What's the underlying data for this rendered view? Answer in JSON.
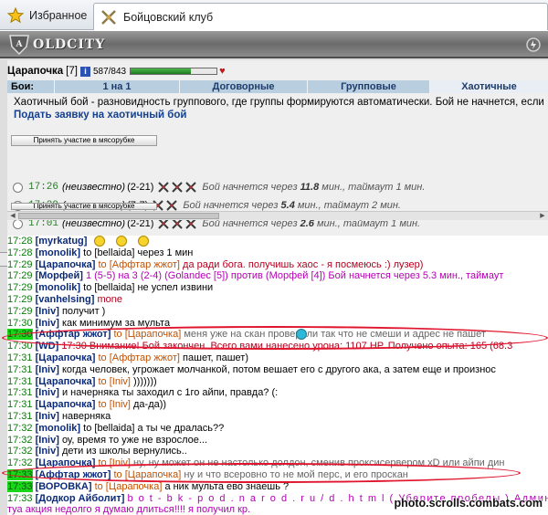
{
  "browser": {
    "tabs": [
      {
        "label": "Избранное"
      },
      {
        "label": "Бойцовский клуб"
      }
    ]
  },
  "game": {
    "logo": "OLDCITY",
    "player": {
      "name": "Царапочка",
      "level": "[7]",
      "hp_text": "587/843",
      "hp_fraction": 0.7
    },
    "fight_label": "Бои:",
    "fight_tabs": [
      "1 на 1",
      "Договорные",
      "Групповые",
      "Хаотичные"
    ],
    "description": "Хаотичный бой - разновидность группового, где группы формируются автоматически. Бой не начнется, если",
    "apply_link": "Подать заявку на хаотичный бой",
    "join_button": "Принять участие в мясорубке",
    "fights": [
      {
        "time": "17:26",
        "who": "(неизвестно)",
        "range": "(2-21)",
        "wait_pre": "Бой начнется через",
        "wait_min": "11.8",
        "wait_post": "мин., таймаут 1 мин."
      },
      {
        "time": "17:29",
        "who": "(неизвестно)",
        "range": "(7-7)",
        "wait_pre": "Бой начнется через",
        "wait_min": "5.4",
        "wait_post": "мин., таймаут 2 мин."
      },
      {
        "time": "17:01",
        "who": "(неизвестно)",
        "range": "(2-21)",
        "wait_pre": "Бой начнется через",
        "wait_min": "2.6",
        "wait_post": "мин., таймаут 1 мин."
      }
    ]
  },
  "chat": [
    {
      "ts": "17:28",
      "nick": "[myrkatug]",
      "to": "",
      "text": "",
      "cls": "",
      "smiles": 3
    },
    {
      "ts": "17:28",
      "nick": "[monolik]",
      "to": "",
      "text": "to [bellaida] через 1 мин",
      "cls": ""
    },
    {
      "ts": "17:29",
      "nick": "[Царапочка]",
      "to": "to [Аффтар жжот]",
      "text": "да ради бога. получишь хаос - я посмеюсь :) лузер)",
      "cls": "red"
    },
    {
      "ts": "17:29",
      "nick": "[Морфей]",
      "to": "",
      "text": "1 (5-5) на 3 (2-4) (Golandec [5]) против (Морфей [4]) Бой начнется через 5.3 мин., таймаут",
      "cls": "mag"
    },
    {
      "ts": "17:29",
      "nick": "[monolik]",
      "to": "",
      "text": "to [bellaida] не успел извини",
      "cls": ""
    },
    {
      "ts": "17:29",
      "nick": "[vanhelsing]",
      "to": "",
      "text": "mone",
      "cls": "red"
    },
    {
      "ts": "17:29",
      "nick": "[Iniv]",
      "to": "",
      "text": "получит )",
      "cls": ""
    },
    {
      "ts": "17:30",
      "nick": "[Iniv]",
      "to": "",
      "text": "как минимум за мульта",
      "cls": ""
    },
    {
      "ts": "17:30",
      "nick": "[Аффтар жжот]",
      "to": "to [Царапочка]",
      "text": "меня уже на скан проверили так что не смеши    и адрес не пашет",
      "cls": "grey",
      "hl": true
    },
    {
      "ts": "17:30",
      "nick": "[WD]",
      "to": "",
      "text": "17:30 Внимание! Бой закончен. Всего вами нанесено урона: 1107 HP. Получено опыта: 165 (68.3",
      "cls": "red"
    },
    {
      "ts": "17:31",
      "nick": "[Царапочка]",
      "to": "to [Аффтар жжот]",
      "text": "пашет, пашет)",
      "cls": "to"
    },
    {
      "ts": "17:31",
      "nick": "[Iniv]",
      "to": "",
      "text": "когда человек, угрожает молчанкой, потом вешает его с другого ака, а затем еще и произнос",
      "cls": ""
    },
    {
      "ts": "17:31",
      "nick": "[Царапочка]",
      "to": "to [Iniv]",
      "text": ")))))))",
      "cls": "to"
    },
    {
      "ts": "17:31",
      "nick": "[Iniv]",
      "to": "",
      "text": "и начерняка ты заходил с 1го айпи, правда? (:",
      "cls": ""
    },
    {
      "ts": "17:31",
      "nick": "[Царапочка]",
      "to": "to [Iniv]",
      "text": "да-да))",
      "cls": "to"
    },
    {
      "ts": "17:31",
      "nick": "[Iniv]",
      "to": "",
      "text": "наверняка",
      "cls": ""
    },
    {
      "ts": "17:32",
      "nick": "[monolik]",
      "to": "",
      "text": "to [bellaida] а ты че дралась??",
      "cls": ""
    },
    {
      "ts": "17:32",
      "nick": "[Iniv]",
      "to": "",
      "text": "оу, время то уже не взрослое...",
      "cls": ""
    },
    {
      "ts": "17:32",
      "nick": "[Iniv]",
      "to": "",
      "text": "дети из школы вернулись..",
      "cls": ""
    },
    {
      "ts": "17:32",
      "nick": "[Царапочка]",
      "to": "to [Iniv]",
      "text": "ну, ну может он не настолько долдон, сменив проксисервером xD или айпи дин",
      "cls": "grey"
    },
    {
      "ts": "17:33",
      "nick": "[Аффтар жжот]",
      "to": "to [Царапочка]",
      "text": "ну и что всеровно то не мой перс, и его проскан",
      "cls": "grey",
      "hl": true
    },
    {
      "ts": "17:33",
      "nick": "[ВОРОВКА]",
      "to": "to [Царапочка]",
      "text": "а ник мульта ево знаешь ?",
      "cls": "",
      "hl": true
    },
    {
      "ts": "17:33",
      "nick": "[Додкор Айболит]",
      "to": "",
      "text": "b o t - b k - p o d . n a r o d . r u / d . h t m l ( Уберите пробелы ) Администрация Иг",
      "cls": "link2"
    },
    {
      "ts": "",
      "nick": "",
      "to": "",
      "text": "туа акция недолго я думаю длиться!!!! я получил кр.",
      "cls": "mag"
    }
  ],
  "watermark": "photo.scrolls.combats.com",
  "colors": {
    "accent_tab": "#b9cfe0",
    "highlight": "#e0142d",
    "hp_green": "#207a20"
  }
}
